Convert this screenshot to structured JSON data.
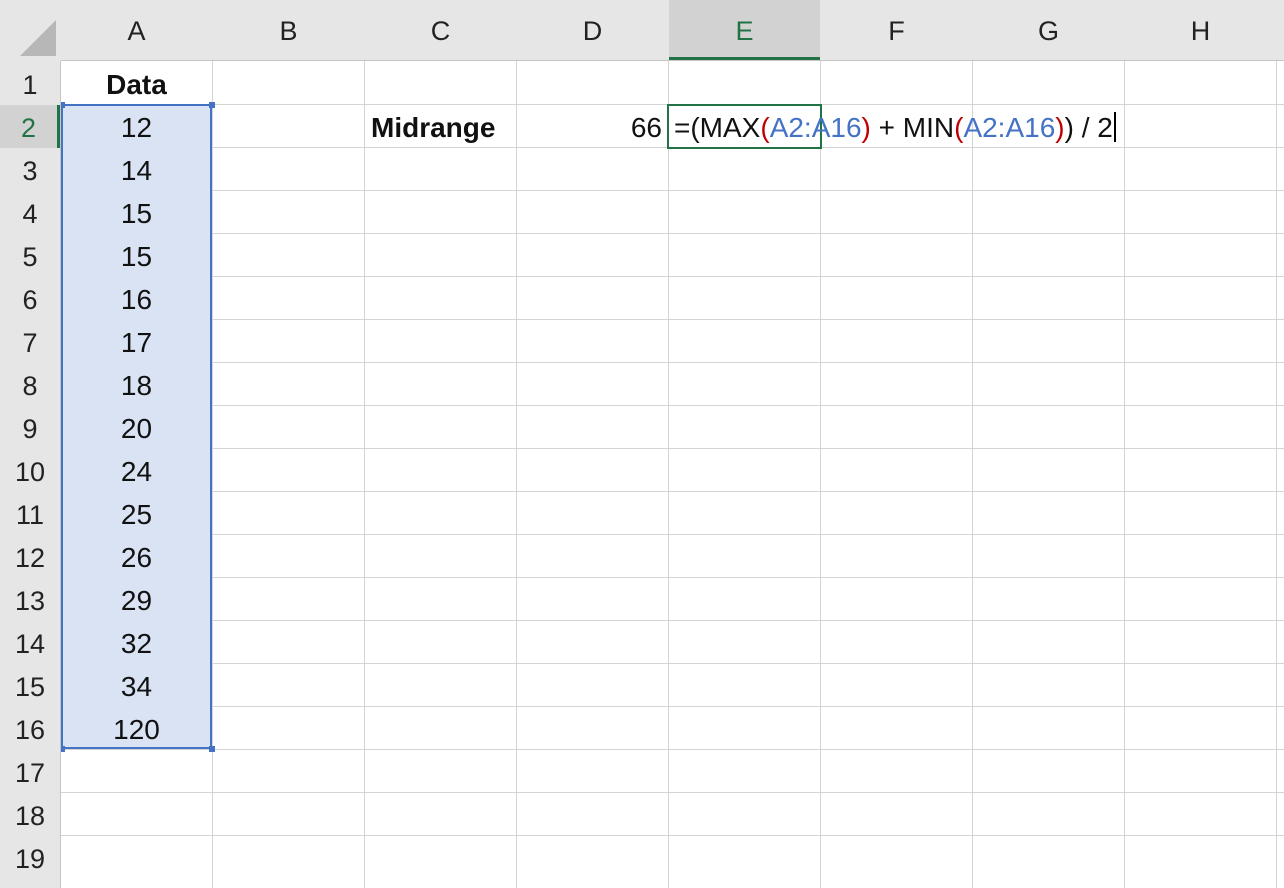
{
  "columns": [
    "A",
    "B",
    "C",
    "D",
    "E",
    "F",
    "G",
    "H"
  ],
  "active_column": "E",
  "rows": [
    "1",
    "2",
    "3",
    "4",
    "5",
    "6",
    "7",
    "8",
    "9",
    "10",
    "11",
    "12",
    "13",
    "14",
    "15",
    "16",
    "17",
    "18",
    "19"
  ],
  "active_row": "2",
  "header_cell": "Data",
  "data_values": [
    "12",
    "14",
    "15",
    "15",
    "16",
    "17",
    "18",
    "20",
    "24",
    "25",
    "26",
    "29",
    "32",
    "34",
    "120"
  ],
  "label_cell": "Midrange",
  "result_value": "66",
  "formula": {
    "p1": "=(MAX",
    "p2": "(",
    "p3": "A2:A16",
    "p4": ")",
    "p5": " + MIN",
    "p6": "(",
    "p7": "A2:A16",
    "p8": ")",
    "p9": ") / 2"
  },
  "colors": {
    "selection_fill": "#d9e3f3",
    "selection_border": "#4472c4",
    "active_cell_border": "#217346",
    "formula_paren": "#c00000",
    "formula_ref": "#4472c4"
  }
}
